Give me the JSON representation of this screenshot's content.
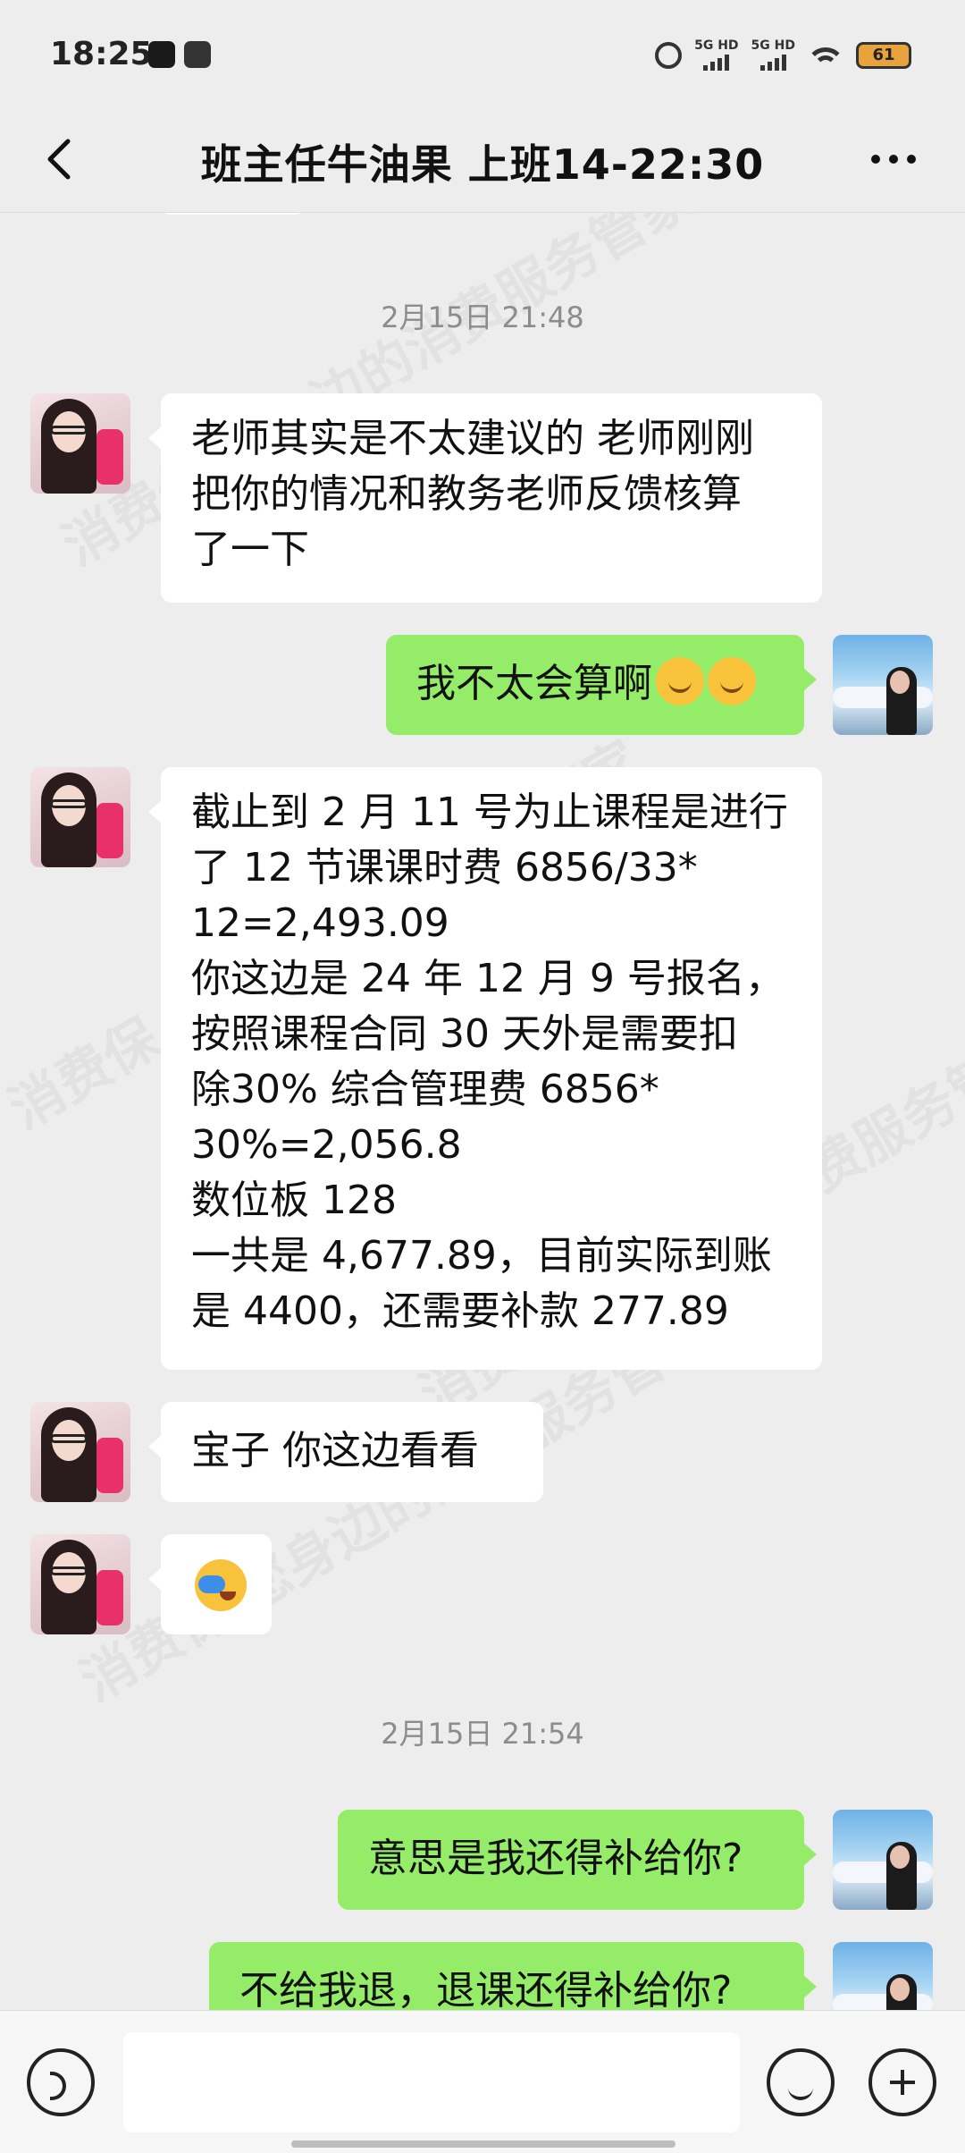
{
  "status_bar": {
    "time": "18:25",
    "network1": "5G HD",
    "network2": "5G HD",
    "battery": "61",
    "icons": [
      "tiktok-icon",
      "message-icon",
      "alarm-icon",
      "signal-icon",
      "wifi-icon",
      "battery-icon"
    ]
  },
  "header": {
    "title": "班主任牛油果  上班14-22:30",
    "back_icon": "back-arrow-icon",
    "more_icon": "more-dots-icon"
  },
  "messages": [
    {
      "type": "timestamp",
      "text": "2月15日 21:48"
    },
    {
      "type": "message",
      "side": "left",
      "text": "老师其实是不太建议的  老师刚刚\n把你的情况和教务老师反馈核算\n了一下"
    },
    {
      "type": "message",
      "side": "right",
      "text": "我不太会算啊",
      "emoji": "smiling-blush-emoji x2"
    },
    {
      "type": "message",
      "side": "left",
      "text": "截止到 2 月 11 号为止课程是进行\n了 12 节课课时费 6856/33*\n12=2,493.09\n你这边是 24 年 12 月 9 号报名，\n按照课程合同 30 天外是需要扣\n除30% 综合管理费 6856*\n30%=2,056.8\n数位板 128\n一共是 4,677.89，目前实际到账\n是 4400，还需要补款 277.89"
    },
    {
      "type": "message",
      "side": "left",
      "text": "宝子  你这边看看"
    },
    {
      "type": "message",
      "side": "left",
      "emoji": "facepalm-cry-emoji"
    },
    {
      "type": "timestamp",
      "text": "2月15日 21:54"
    },
    {
      "type": "message",
      "side": "right",
      "text": "意思是我还得补给你?"
    },
    {
      "type": "message",
      "side": "right",
      "text": "不给我退，退课还得补给你?"
    }
  ],
  "watermark": "消费保 您身边的消费服务管家",
  "input_bar": {
    "voice_icon": "voice-icon",
    "emoji_icon": "emoji-icon",
    "plus_icon": "plus-icon"
  }
}
